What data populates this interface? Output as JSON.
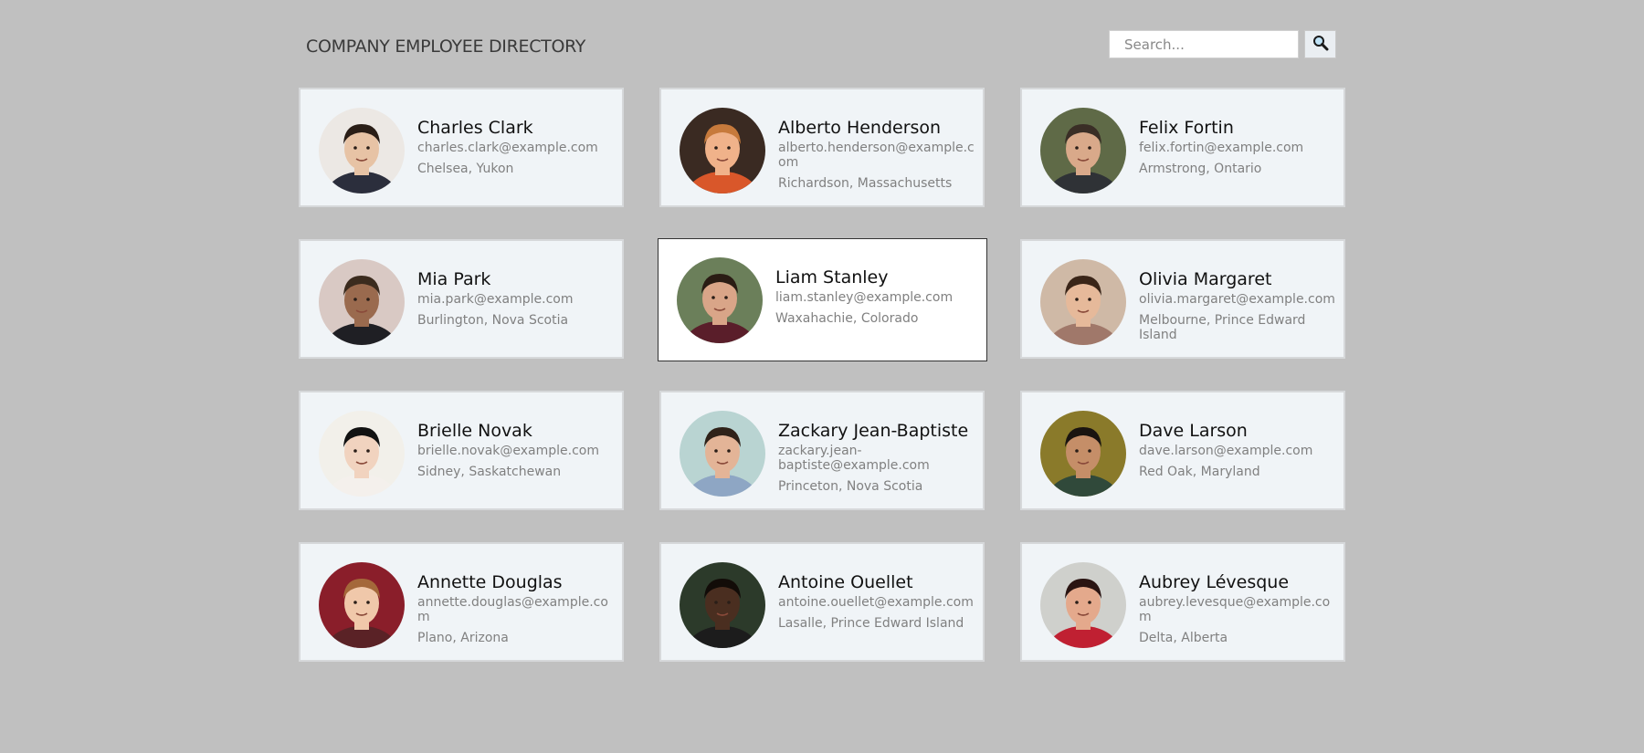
{
  "header": {
    "title": "COMPANY EMPLOYEE DIRECTORY"
  },
  "search": {
    "placeholder": "Search..."
  },
  "employees": [
    {
      "name": "Charles Clark",
      "email": "charles.clark@example.com",
      "location": "Chelsea, Yukon",
      "skin": "#e7c3a5",
      "hair": "#2a1e17",
      "shirt": "#2b2e3c",
      "bg": "#ece8e4",
      "active": false
    },
    {
      "name": "Alberto Henderson",
      "email": "alberto.henderson@example.com",
      "location": "Richardson, Massachusetts",
      "skin": "#f0b28a",
      "hair": "#c77a3c",
      "shirt": "#d9572a",
      "bg": "#3a2a22",
      "active": false
    },
    {
      "name": "Felix Fortin",
      "email": "felix.fortin@example.com",
      "location": "Armstrong, Ontario",
      "skin": "#d9a98a",
      "hair": "#3a2e26",
      "shirt": "#2f3236",
      "bg": "#5f6a47",
      "active": false
    },
    {
      "name": "Mia Park",
      "email": "mia.park@example.com",
      "location": "Burlington, Nova Scotia",
      "skin": "#9a6a4e",
      "hair": "#3b2b1e",
      "shirt": "#1f1f24",
      "bg": "#d9c9c4",
      "active": false
    },
    {
      "name": "Liam Stanley",
      "email": "liam.stanley@example.com",
      "location": "Waxahachie, Colorado",
      "skin": "#d9a588",
      "hair": "#2a1c14",
      "shirt": "#5a1e2a",
      "bg": "#6b7f5a",
      "active": true
    },
    {
      "name": "Olivia Margaret",
      "email": "olivia.margaret@example.com",
      "location": "Melbourne, Prince Edward Island",
      "skin": "#e6b99a",
      "hair": "#3a2518",
      "shirt": "#a0786a",
      "bg": "#cfb9a6",
      "active": false
    },
    {
      "name": "Brielle Novak",
      "email": "brielle.novak@example.com",
      "location": "Sidney, Saskatchewan",
      "skin": "#f1d3bf",
      "hair": "#121212",
      "shirt": "#f4f0ec",
      "bg": "#f2f0ea",
      "active": false
    },
    {
      "name": "Zackary Jean-Baptiste",
      "email": "zackary.jean-baptiste@example.com",
      "location": "Princeton, Nova Scotia",
      "skin": "#e3b497",
      "hair": "#2f2219",
      "shirt": "#8ea6c4",
      "bg": "#b9d4d2",
      "active": false
    },
    {
      "name": "Dave Larson",
      "email": "dave.larson@example.com",
      "location": "Red Oak, Maryland",
      "skin": "#c58e68",
      "hair": "#1a1410",
      "shirt": "#30493a",
      "bg": "#8a7a2a",
      "active": false
    },
    {
      "name": "Annette Douglas",
      "email": "annette.douglas@example.com",
      "location": "Plano, Arizona",
      "skin": "#f0c8aa",
      "hair": "#a4683a",
      "shirt": "#5a2226",
      "bg": "#8a1e2a",
      "active": false
    },
    {
      "name": "Antoine Ouellet",
      "email": "antoine.ouellet@example.com",
      "location": "Lasalle, Prince Edward Island",
      "skin": "#4a2e20",
      "hair": "#120c08",
      "shirt": "#1c1c1c",
      "bg": "#2c3a2a",
      "active": false
    },
    {
      "name": "Aubrey Lévesque",
      "email": "aubrey.levesque@example.com",
      "location": "Delta, Alberta",
      "skin": "#e4a98c",
      "hair": "#2a1412",
      "shirt": "#c02032",
      "bg": "#cfd0cc",
      "active": false
    }
  ]
}
